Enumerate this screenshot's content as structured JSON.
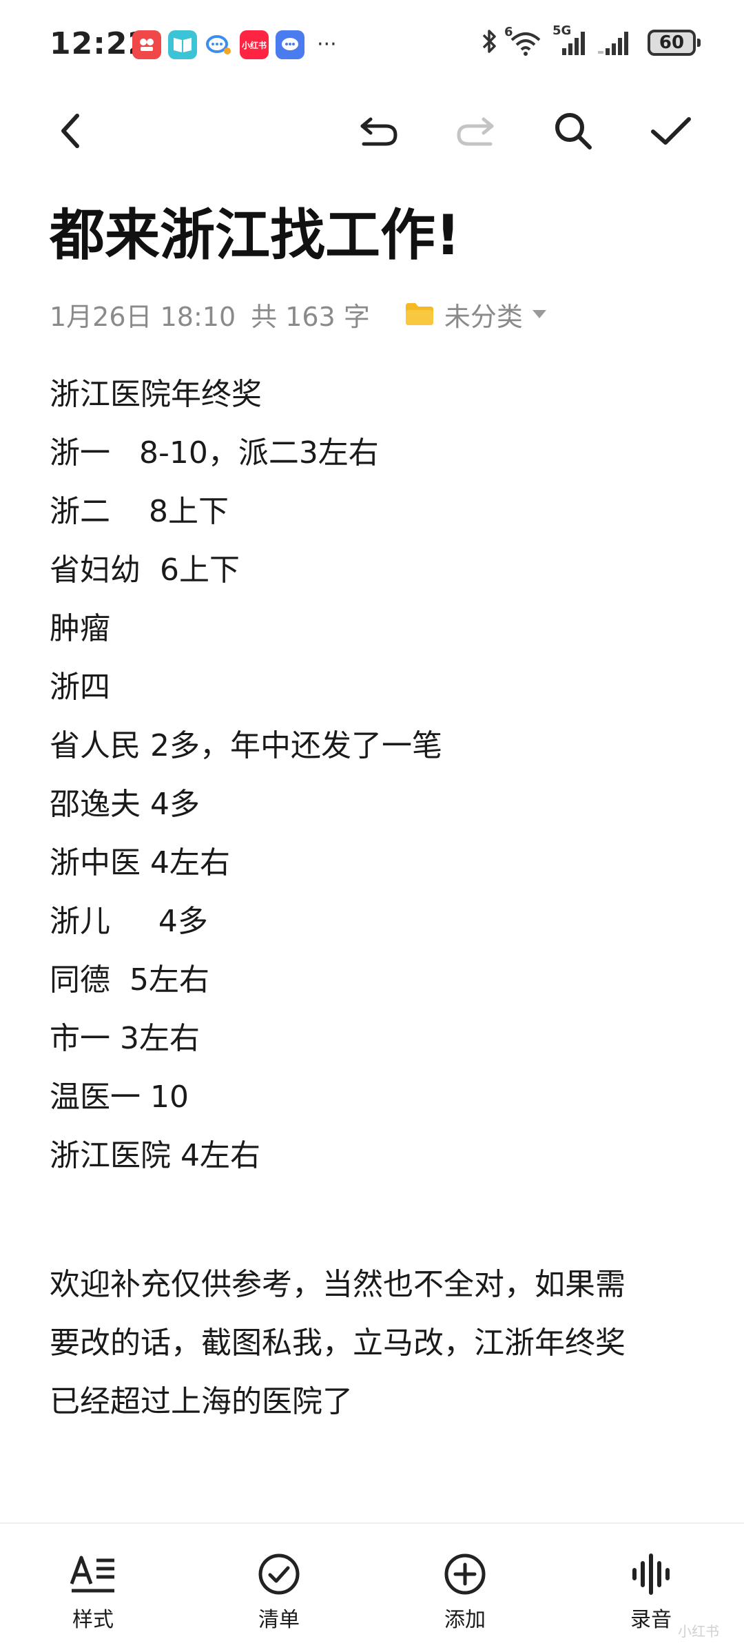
{
  "status_bar": {
    "time": "12:22",
    "battery": "60",
    "network": "5G",
    "wifi_badge": "6",
    "notification_icons": [
      "app-icon-red",
      "reader-icon",
      "chat-bubble-icon",
      "xiaohongshu-icon",
      "message-icon"
    ],
    "app_label_small": "小红书",
    "more": "···"
  },
  "toolbar": {
    "back": "back-icon",
    "undo": "undo-icon",
    "redo": "redo-icon",
    "search": "search-icon",
    "done": "check-icon"
  },
  "note": {
    "title": "都来浙江找工作!",
    "date": "1月26日 18:10",
    "word_count": "共 163 字",
    "folder": "未分类",
    "lines": [
      "浙江医院年终奖",
      "浙一   8-10，派二3左右",
      "浙二    8上下",
      "省妇幼  6上下",
      "肿瘤",
      "浙四",
      "省人民 2多，年中还发了一笔",
      "邵逸夫 4多",
      "浙中医 4左右",
      "浙儿     4多",
      "同德  5左右",
      "市一 3左右",
      "温医一 10",
      "浙江医院 4左右"
    ],
    "paragraph_lines": [
      "欢迎补充仅供参考，当然也不全对，如果需",
      "要改的话，截图私我，立马改，江浙年终奖",
      "已经超过上海的医院了"
    ]
  },
  "bottom_bar": {
    "style": "样式",
    "checklist": "清单",
    "add": "添加",
    "record": "录音"
  },
  "colors": {
    "folder": "#f5b921",
    "meta_text": "#8a8a8a",
    "body_text": "#1a1a1a"
  }
}
